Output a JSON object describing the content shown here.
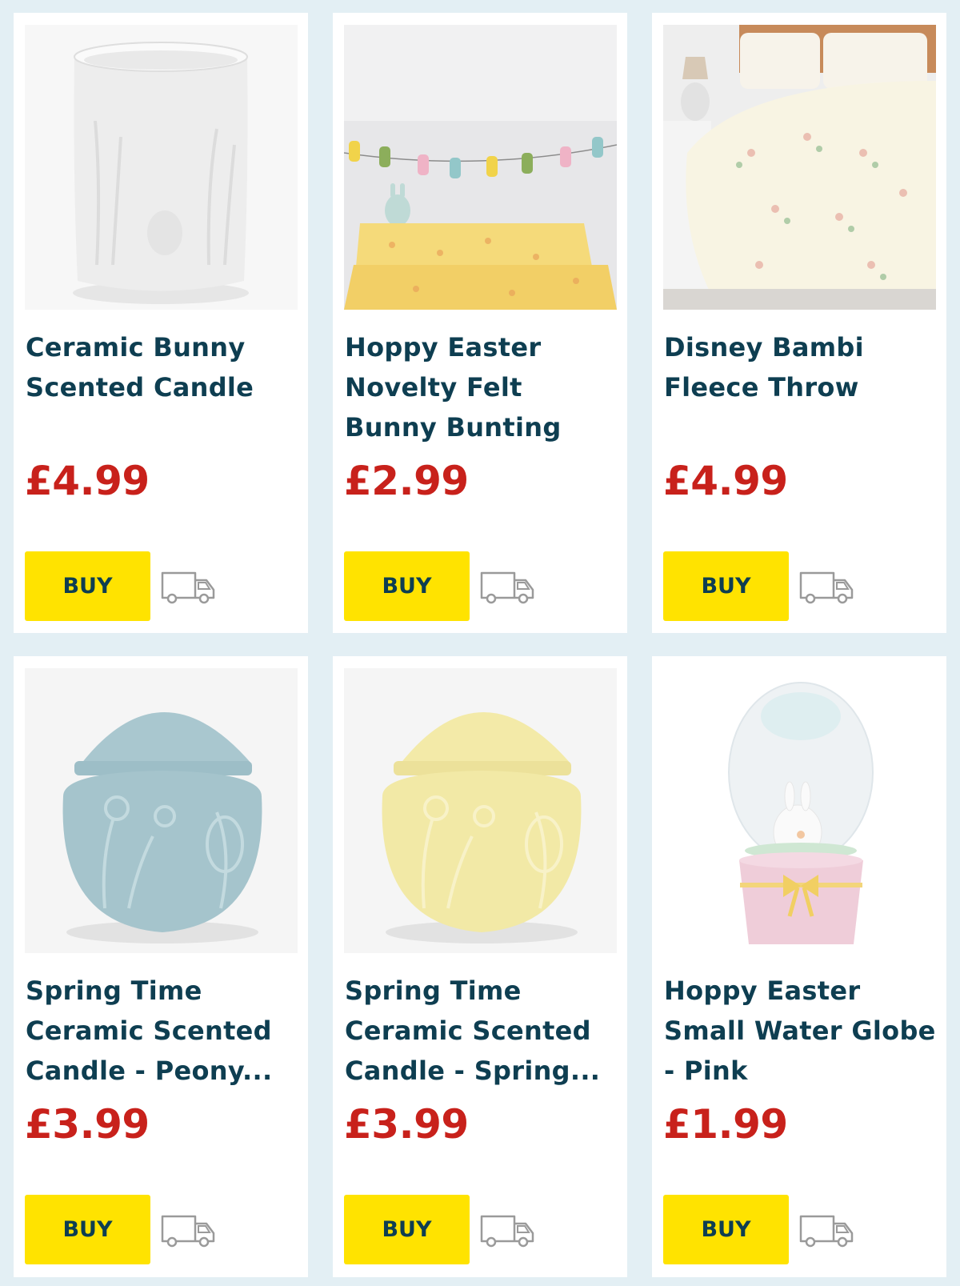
{
  "products": [
    {
      "title": "Ceramic Bunny Scented Candle",
      "price": "£4.99",
      "buy_label": "BUY",
      "image": "white-ceramic-candle-pot",
      "delivery_icon": "delivery-van-icon"
    },
    {
      "title": "Hoppy Easter Novelty Felt Bunny Bunting",
      "price": "£2.99",
      "buy_label": "BUY",
      "image": "felt-bunny-bunting",
      "delivery_icon": "delivery-van-icon"
    },
    {
      "title": "Disney Bambi Fleece Throw",
      "price": "£4.99",
      "buy_label": "BUY",
      "image": "bambi-fleece-throw-on-bed",
      "delivery_icon": "delivery-van-icon"
    },
    {
      "title": "Spring Time Ceramic Scented Candle - Peony...",
      "price": "£3.99",
      "buy_label": "BUY",
      "image": "blue-ceramic-egg-candle",
      "delivery_icon": "delivery-van-icon"
    },
    {
      "title": "Spring Time Ceramic Scented Candle - Spring...",
      "price": "£3.99",
      "buy_label": "BUY",
      "image": "yellow-ceramic-egg-candle",
      "delivery_icon": "delivery-van-icon"
    },
    {
      "title": "Hoppy Easter Small Water Globe - Pink",
      "price": "£1.99",
      "buy_label": "BUY",
      "image": "egg-water-globe-pink-base",
      "delivery_icon": "delivery-van-icon"
    }
  ],
  "colors": {
    "background": "#e3eff4",
    "card": "#ffffff",
    "title": "#0e3e51",
    "price": "#c8211b",
    "buy_button": "#ffe300",
    "icon_stroke": "#9a9a9a"
  }
}
